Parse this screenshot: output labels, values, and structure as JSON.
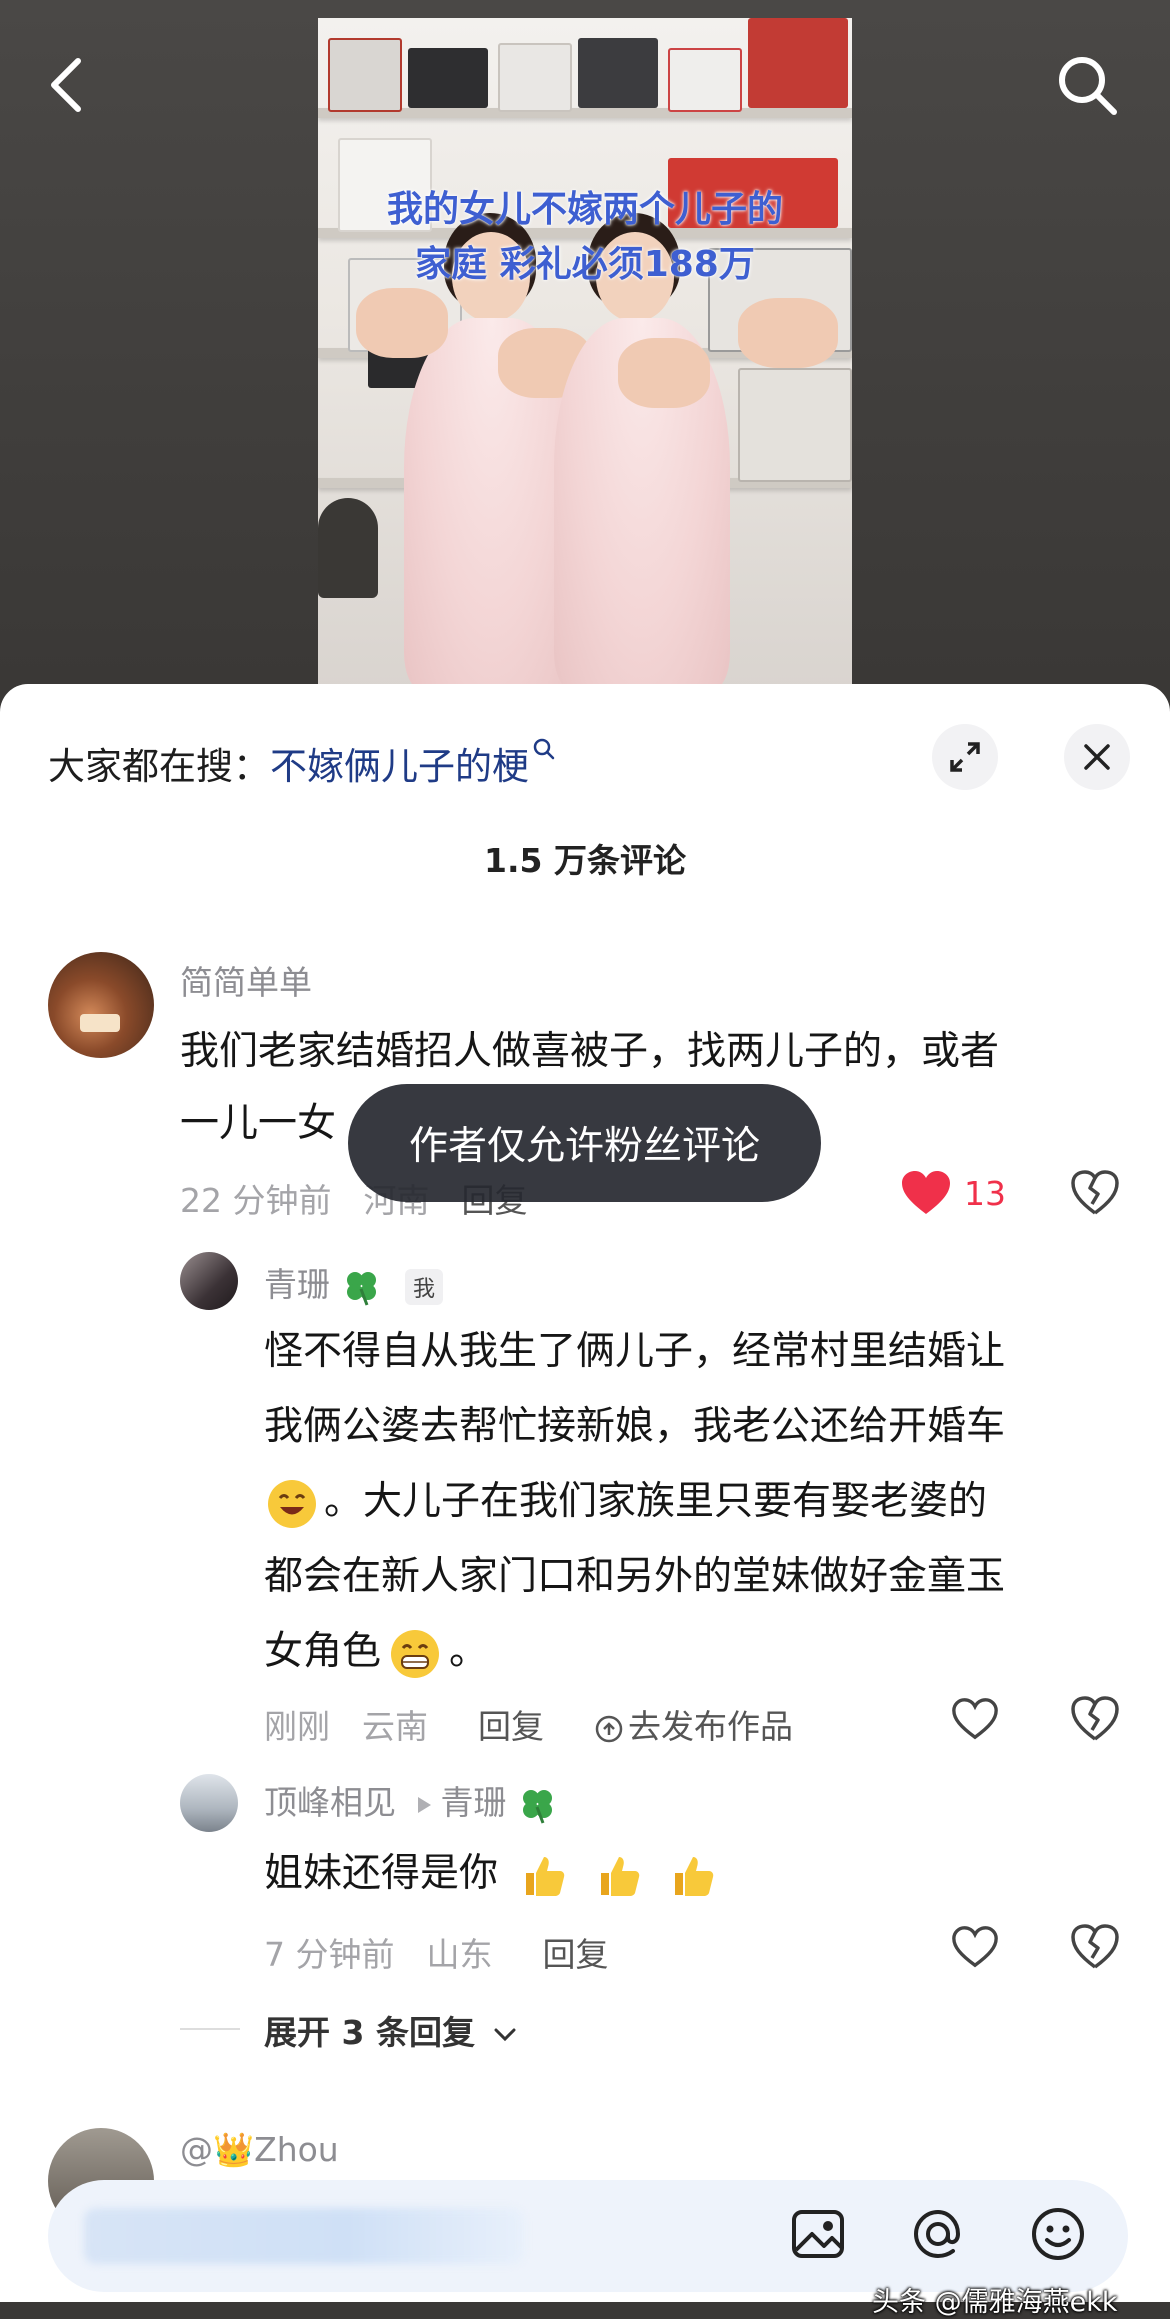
{
  "video": {
    "overlay_line1": "我的女儿不嫁两个儿子的",
    "overlay_line2": "家庭 彩礼必须188万"
  },
  "colors": {
    "overlay_text": "#3e5fd1",
    "search_keyword": "#1f3b86",
    "like_active": "#f0304a",
    "toast_bg": "#26282f"
  },
  "search": {
    "label": "大家都在搜：",
    "keyword": "不嫁俩儿子的梗"
  },
  "comments_count": "1.5 万条评论",
  "comments": [
    {
      "user": "简简单单",
      "text_line1": "我们老家结婚招人做喜被子，找两儿子的，或者",
      "text_line2": "一儿一女",
      "time": "22 分钟前",
      "location": "河南",
      "reply": "回复",
      "likes": "13",
      "liked": true
    }
  ],
  "replies": [
    {
      "user": "青珊",
      "badge": "我",
      "text_line1": "怪不得自从我生了俩儿子，经常村里结婚让",
      "text_line2": "我俩公婆去帮忙接新娘，我老公还给开婚车",
      "text_line3": "。大儿子在我们家族里只要有娶老婆的",
      "text_line4": "都会在新人家门口和另外的堂妹做好金童玉",
      "text_line5": "女角色",
      "text_line5_end": "。",
      "time": "刚刚",
      "location": "云南",
      "reply": "回复",
      "publish": "去发布作品"
    },
    {
      "user": "顶峰相见",
      "reply_to": "青珊",
      "text": "姐妹还得是你",
      "time": "7 分钟前",
      "location": "山东",
      "reply": "回复"
    }
  ],
  "expand_label": "展开 3 条回复",
  "next_user": "@👑Zhou",
  "toast": "作者仅允许粉丝评论",
  "watermark": "头条 @儒雅海燕ekk",
  "icons": [
    "back-icon",
    "search-icon",
    "fullscreen-icon",
    "close-icon",
    "heart-icon",
    "broken-heart-icon",
    "clover-icon",
    "image-icon",
    "at-icon",
    "emoji-icon",
    "upload-icon"
  ]
}
